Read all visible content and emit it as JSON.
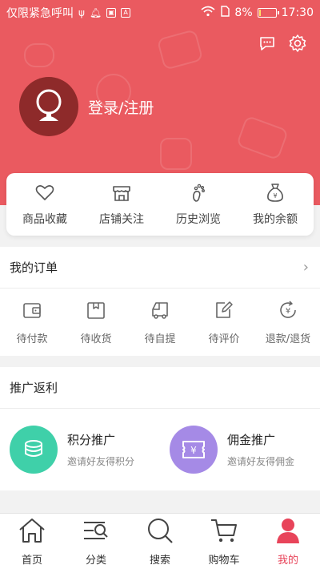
{
  "status_bar": {
    "carrier": "仅限紧急呼叫",
    "battery_percent": "8%",
    "battery_level": 0.08,
    "time": "17:30",
    "icons": [
      "usb-icon",
      "mute-icon",
      "image-icon",
      "a-icon",
      "wifi-icon",
      "sim-icon",
      "battery-icon"
    ]
  },
  "header": {
    "login_label": "登录/注册",
    "actions": [
      "message-icon",
      "gear-icon"
    ],
    "avatar_icon": "user-avatar-icon",
    "background_color": "#ea5a60"
  },
  "quick": {
    "items": [
      {
        "label": "商品收藏",
        "icon": "heart-icon"
      },
      {
        "label": "店铺关注",
        "icon": "store-icon"
      },
      {
        "label": "历史浏览",
        "icon": "footprint-icon"
      },
      {
        "label": "我的余额",
        "icon": "money-bag-icon"
      }
    ]
  },
  "orders": {
    "title": "我的订单",
    "items": [
      {
        "label": "待付款",
        "icon": "wallet-icon"
      },
      {
        "label": "待收货",
        "icon": "package-icon"
      },
      {
        "label": "待自提",
        "icon": "truck-icon"
      },
      {
        "label": "待评价",
        "icon": "edit-icon"
      },
      {
        "label": "退款/退货",
        "icon": "refund-icon"
      }
    ]
  },
  "promo": {
    "title": "推广返利",
    "items": [
      {
        "title": "积分推广",
        "subtitle": "邀请好友得积分",
        "icon": "coins-icon",
        "color": "#3fd0a9"
      },
      {
        "title": "佣金推广",
        "subtitle": "邀请好友得佣金",
        "icon": "yen-ticket-icon",
        "color": "#a58ae6"
      }
    ]
  },
  "tabbar": {
    "active_color": "#e8445a",
    "items": [
      {
        "label": "首页",
        "icon": "home-icon"
      },
      {
        "label": "分类",
        "icon": "category-search-icon"
      },
      {
        "label": "搜索",
        "icon": "search-icon"
      },
      {
        "label": "购物车",
        "icon": "cart-icon"
      },
      {
        "label": "我的",
        "icon": "user-icon",
        "active": true
      }
    ]
  }
}
